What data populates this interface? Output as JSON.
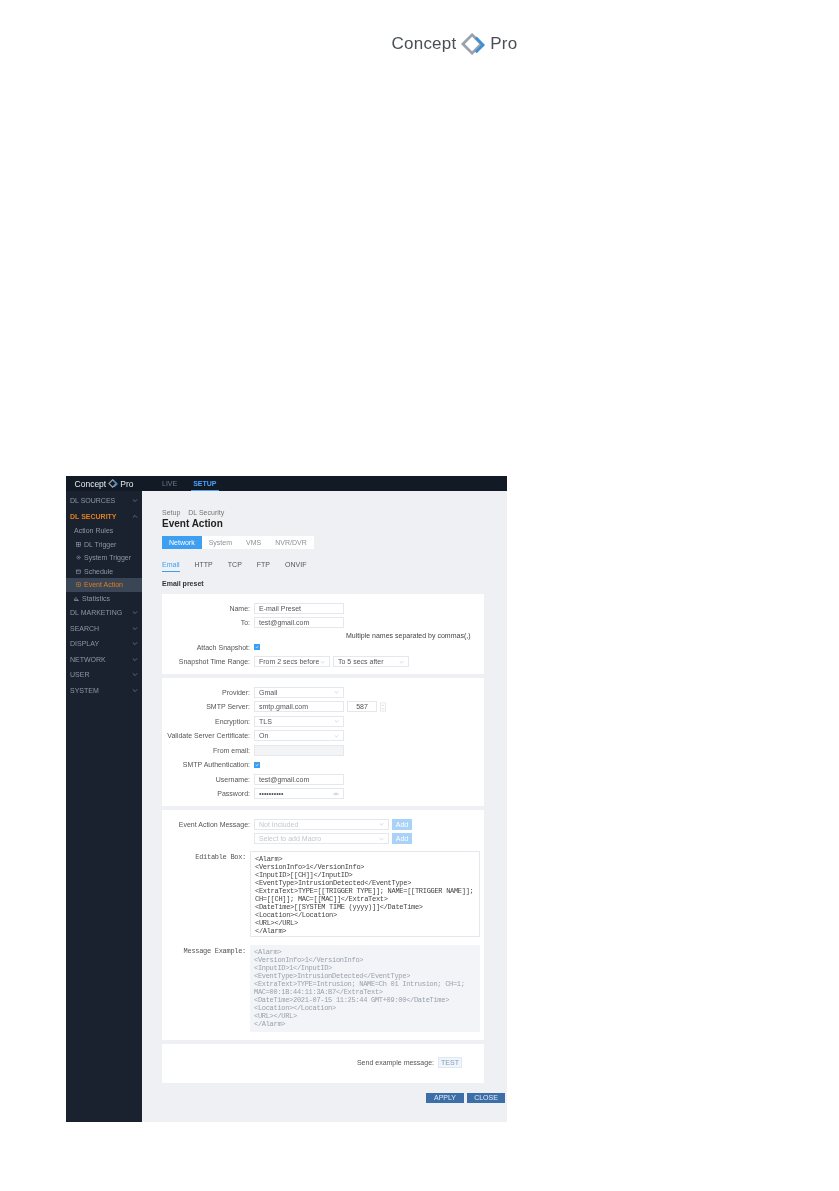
{
  "document_header": {
    "logo": [
      "Concept",
      "Pro"
    ]
  },
  "app": {
    "logo": [
      "Concept",
      "Pro"
    ],
    "top_nav": [
      {
        "label": "LIVE",
        "selected": false
      },
      {
        "label": "SETUP",
        "selected": true
      }
    ],
    "sidebar": [
      {
        "label": "DL SOURCES",
        "expanded": false,
        "selected": false
      },
      {
        "label": "DL SECURITY",
        "expanded": true,
        "selected": true,
        "children": [
          {
            "label": "Action Rules",
            "children": [
              {
                "label": "DL Trigger",
                "selected": false
              },
              {
                "label": "System Trigger",
                "selected": false
              },
              {
                "label": "Schedule",
                "selected": false
              },
              {
                "label": "Event Action",
                "selected": true
              }
            ]
          },
          {
            "label": "Statistics",
            "selected": false
          }
        ]
      },
      {
        "label": "DL MARKETING",
        "expanded": false,
        "selected": false
      },
      {
        "label": "SEARCH",
        "expanded": false,
        "selected": false
      },
      {
        "label": "DISPLAY",
        "expanded": false,
        "selected": false
      },
      {
        "label": "NETWORK",
        "expanded": false,
        "selected": false
      },
      {
        "label": "USER",
        "expanded": false,
        "selected": false
      },
      {
        "label": "SYSTEM",
        "expanded": false,
        "selected": false
      }
    ],
    "breadcrumb": [
      "Setup",
      "DL Security"
    ],
    "title": "Event Action",
    "category_tabs": [
      {
        "label": "Network",
        "selected": true
      },
      {
        "label": "System",
        "selected": false
      },
      {
        "label": "VMS",
        "selected": false
      },
      {
        "label": "NVR/DVR",
        "selected": false
      }
    ],
    "protocol_tabs": [
      {
        "label": "Email",
        "selected": true
      },
      {
        "label": "HTTP",
        "selected": false
      },
      {
        "label": "TCP",
        "selected": false
      },
      {
        "label": "FTP",
        "selected": false
      },
      {
        "label": "ONVIF",
        "selected": false
      }
    ],
    "section_title": "Email preset",
    "cards": [
      {
        "rows": [
          {
            "kind": "input",
            "label": "Name:",
            "value": "E-mail Preset"
          },
          {
            "kind": "input",
            "label": "To:",
            "value": "test@gmail.com"
          },
          {
            "kind": "hint",
            "text": "Multiple names separated by commas(,)"
          },
          {
            "kind": "checkbox",
            "label": "Attach Snapshot:",
            "checked": true
          },
          {
            "kind": "select_pair",
            "label": "Snapshot Time Range:",
            "values": [
              "From 2 secs before",
              "To 5 secs after"
            ]
          }
        ]
      },
      {
        "rows": [
          {
            "kind": "select",
            "label": "Provider:",
            "value": "Gmail"
          },
          {
            "kind": "input_port",
            "label": "SMTP Server:",
            "value": "smtp.gmail.com",
            "port": "587"
          },
          {
            "kind": "select",
            "label": "Encryption:",
            "value": "TLS"
          },
          {
            "kind": "select",
            "label": "Validate Server Certificate:",
            "value": "On"
          },
          {
            "kind": "disabled",
            "label": "From email:"
          },
          {
            "kind": "checkbox",
            "label": "SMTP Authentication:",
            "checked": true
          },
          {
            "kind": "input",
            "label": "Username:",
            "value": "test@gmail.com"
          },
          {
            "kind": "password",
            "label": "Password:",
            "value": "••••••••••"
          }
        ]
      },
      {
        "rows": [
          {
            "kind": "select_button",
            "label": "Event Action Message:",
            "placeholder": "Not Included",
            "button": "Add"
          },
          {
            "kind": "select_button",
            "placeholder": "Select to add Macro",
            "button": "Add"
          },
          {
            "kind": "code",
            "label": "Editable Box:",
            "editable": true,
            "lines": [
              "<Alarm>",
              "<VersionInfo>1</VersionInfo>",
              "<InputID>[[CH]]</InputID>",
              "<EventType>IntrusionDetected</EventType>",
              "<ExtraText>TYPE=[[TRIGGER TYPE]]; NAME=[[TRIGGER NAME]];",
              "CH=[[CH]]; MAC=[[MAC]]</ExtraText>",
              "<DateTime>[[SYSTEM TIME (yyyy)]]</DateTime>",
              "<Location></Location>",
              "<URL></URL>",
              "</Alarm>"
            ]
          },
          {
            "kind": "code",
            "label": "Message Example:",
            "editable": false,
            "lines": [
              "<Alarm>",
              "<VersionInfo>1</VersionInfo>",
              "<InputID>1</InputID>",
              "<EventType>IntrusionDetected</EventType>",
              "<ExtraText>TYPE=Intrusion; NAME=Ch 01 Intrusion; CH=1;",
              "MAC=00:1B:44:11:3A:B7</ExtraText>",
              "<DateTime>2021-07-15 11:25:44 GMT+09:00</DateTime>",
              "<Location></Location>",
              "<URL></URL>",
              "</Alarm>"
            ]
          }
        ]
      },
      {
        "rows": [
          {
            "kind": "send",
            "label": "Send example message:",
            "button": "TEST"
          }
        ]
      }
    ],
    "footer_buttons": [
      "APPLY",
      "CLOSE"
    ]
  }
}
